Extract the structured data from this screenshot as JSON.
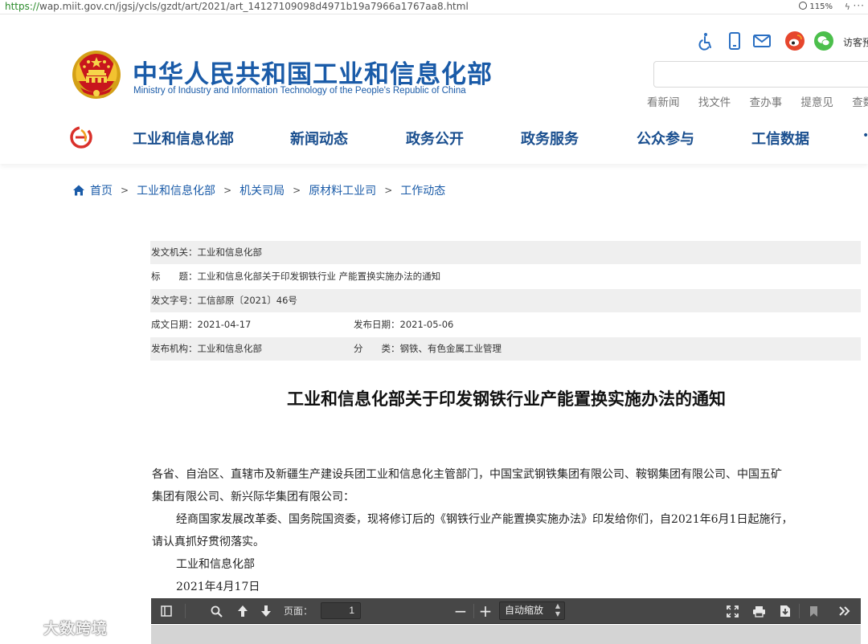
{
  "browser": {
    "url_protocol": "https://",
    "url_rest": "wap.miit.gov.cn/jgsj/ycls/gzdt/art/2021/art_14127109098d4971b19a7966a1767aa8.html",
    "zoom": "115%"
  },
  "header": {
    "title": "中华人民共和国工业和信息化部",
    "subtitle": "Ministry of Industry and Information Technology of the People's Republic of China",
    "visitor_label": "访客预",
    "quick_links": [
      "看新闻",
      "找文件",
      "查办事",
      "提意见",
      "查数"
    ]
  },
  "nav": {
    "items": [
      "工业和信息化部",
      "新闻动态",
      "政务公开",
      "政务服务",
      "公众参与",
      "工信数据"
    ]
  },
  "breadcrumb": {
    "items": [
      "首页",
      "工业和信息化部",
      "机关司局",
      "原材料工业司",
      "工作动态"
    ],
    "separator": ">"
  },
  "meta": {
    "issuer": "发文机关：工业和信息化部",
    "title": "标　　题：工业和信息化部关于印发钢铁行业 产能置换实施办法的通知",
    "doc_no": "发文字号：工信部原〔2021〕46号",
    "created": "成文日期：2021-04-17",
    "published": "发布日期：2021-05-06",
    "publisher": "发布机构：工业和信息化部",
    "category": "分　　类：钢铁、有色金属工业管理"
  },
  "document": {
    "title": "工业和信息化部关于印发钢铁行业产能置换实施办法的通知",
    "line1": "各省、自治区、直辖市及新疆生产建设兵团工业和信息化主管部门，中国宝武钢铁集团有限公司、鞍钢集团有限公司、中国五矿",
    "line2": "集团有限公司、新兴际华集团有限公司：",
    "line3": "经商国家发展改革委、国务院国资委，现将修订后的《钢铁行业产能置换实施办法》印发给你们，自2021年6月1日起施行，",
    "line4": "请认真抓好贯彻落实。",
    "signature": "工业和信息化部",
    "date": "2021年4月17日"
  },
  "pdf_toolbar": {
    "page_label": "页面：",
    "page_value": "1",
    "zoom_option": "自动缩放"
  },
  "watermark": {
    "text": "大数跨境"
  },
  "colors": {
    "brand_blue": "#1a5ba8",
    "nav_blue": "#1a4f8f",
    "toolbar_bg": "#474747",
    "weibo_red": "#e6462d",
    "wechat_green": "#4cbf4c"
  }
}
